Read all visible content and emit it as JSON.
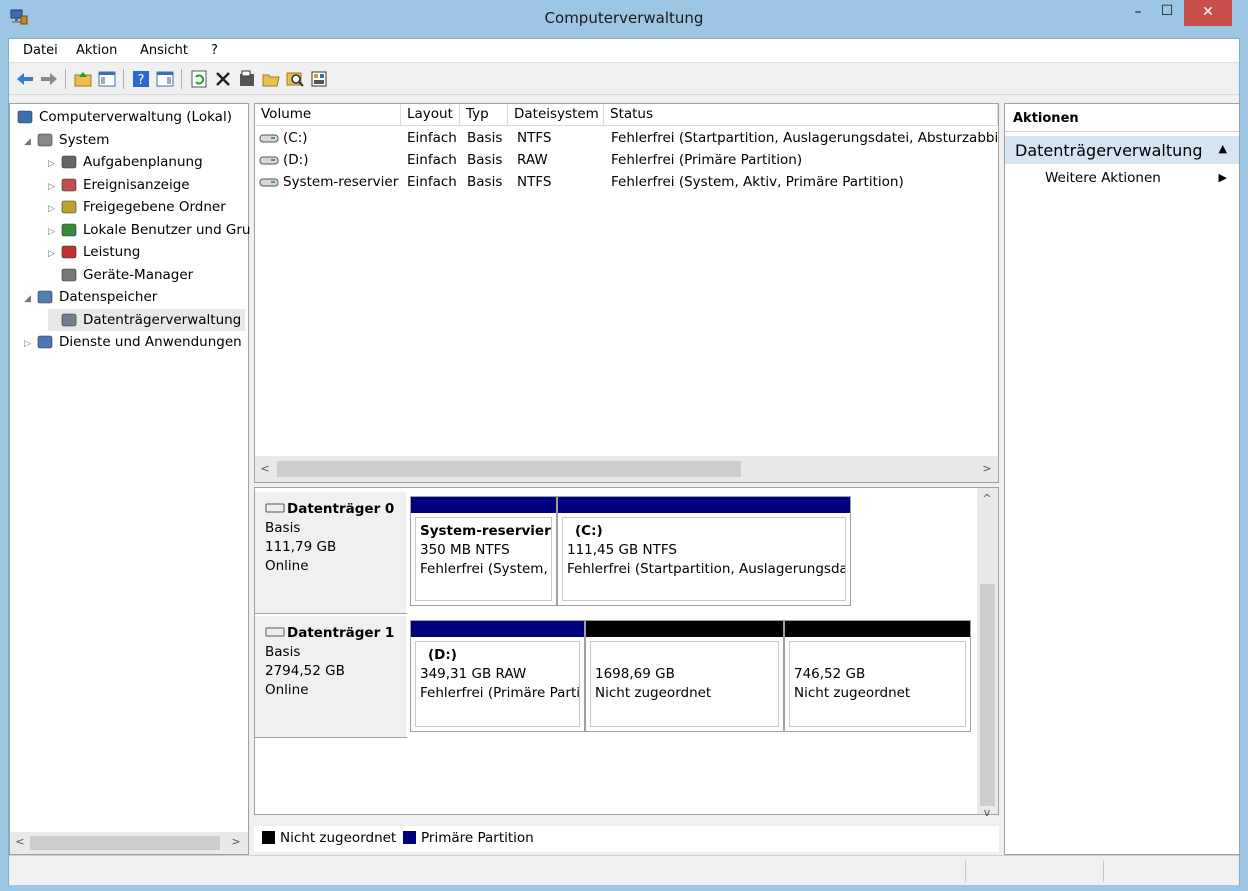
{
  "window": {
    "title": "Computerverwaltung",
    "minimize": "–",
    "maximize": "☐",
    "close": "✕"
  },
  "menu": [
    "Datei",
    "Aktion",
    "Ansicht",
    "?"
  ],
  "tree": [
    {
      "label": "Computerverwaltung (Lokal)",
      "exp": "",
      "level": 0
    },
    {
      "label": "System",
      "exp": "◢",
      "level": 1
    },
    {
      "label": "Aufgabenplanung",
      "exp": "▷",
      "level": 2
    },
    {
      "label": "Ereignisanzeige",
      "exp": "▷",
      "level": 2
    },
    {
      "label": "Freigegebene Ordner",
      "exp": "▷",
      "level": 2
    },
    {
      "label": "Lokale Benutzer und Gru",
      "exp": "▷",
      "level": 2
    },
    {
      "label": "Leistung",
      "exp": "▷",
      "level": 2
    },
    {
      "label": "Geräte-Manager",
      "exp": "",
      "level": 2
    },
    {
      "label": "Datenspeicher",
      "exp": "◢",
      "level": 1
    },
    {
      "label": "Datenträgerverwaltung",
      "exp": "",
      "level": 2
    },
    {
      "label": "Dienste und Anwendungen",
      "exp": "▷",
      "level": 1
    }
  ],
  "volumes": {
    "headers": [
      "Volume",
      "Layout",
      "Typ",
      "Dateisystem",
      "Status"
    ],
    "rows": [
      [
        "(C:)",
        "Einfach",
        "Basis",
        "NTFS",
        "Fehlerfrei (Startpartition, Auslagerungsdatei, Absturzabbild"
      ],
      [
        "(D:)",
        "Einfach",
        "Basis",
        "RAW",
        "Fehlerfrei (Primäre Partition)"
      ],
      [
        "System-reserviert",
        "Einfach",
        "Basis",
        "NTFS",
        "Fehlerfrei (System, Aktiv, Primäre Partition)"
      ]
    ]
  },
  "disks": [
    {
      "name": "Datenträger 0",
      "type": "Basis",
      "size": "111,79 GB",
      "state": "Online",
      "partitions": [
        {
          "title": "System-reserviert",
          "size": "350 MB NTFS",
          "status": "Fehlerfrei (System, Aktiv, Primäre Partition)",
          "kind": "primary"
        },
        {
          "title": "(C:)",
          "size": "111,45 GB NTFS",
          "status": "Fehlerfrei (Startpartition, Auslagerungsdatei, Absturzabbild, Primäre Partition)",
          "kind": "primary"
        }
      ]
    },
    {
      "name": "Datenträger 1",
      "type": "Basis",
      "size": "2794,52 GB",
      "state": "Online",
      "partitions": [
        {
          "title": "(D:)",
          "size": "349,31 GB RAW",
          "status": "Fehlerfrei (Primäre Partition)",
          "kind": "primary"
        },
        {
          "title": "",
          "size": "1698,69 GB",
          "status": "Nicht zugeordnet",
          "kind": "unallocated"
        },
        {
          "title": "",
          "size": "746,52 GB",
          "status": "Nicht zugeordnet",
          "kind": "unallocated"
        }
      ]
    }
  ],
  "legend": {
    "unallocated": "Nicht zugeordnet",
    "primary": "Primäre Partition"
  },
  "colors": {
    "primary": "#00007f",
    "unallocated": "#000000",
    "actions_selected": "#d4e4f2",
    "close": "#c7504a"
  },
  "actions": {
    "header": "Aktionen",
    "section": "Datenträgerverwaltung",
    "item": "Weitere Aktionen"
  }
}
